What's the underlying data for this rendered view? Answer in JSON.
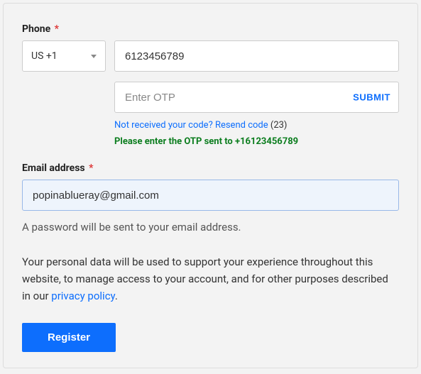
{
  "phone": {
    "label": "Phone",
    "required": "*",
    "country_code": "US +1",
    "number": "6123456789"
  },
  "otp": {
    "placeholder": "Enter OTP",
    "submit": "SUBMIT",
    "resend_text": "Not received your code? Resend code",
    "countdown": "(23)",
    "sent_msg": "Please enter the OTP sent to +16123456789"
  },
  "email": {
    "label": "Email address",
    "required": "*",
    "value": "popinablueray@gmail.com"
  },
  "hint": "A password will be sent to your email address.",
  "privacy": {
    "prefix": "Your personal data will be used to support your experience throughout this website, to manage access to your account, and for other purposes described in our ",
    "link": "privacy policy",
    "suffix": "."
  },
  "register": "Register"
}
